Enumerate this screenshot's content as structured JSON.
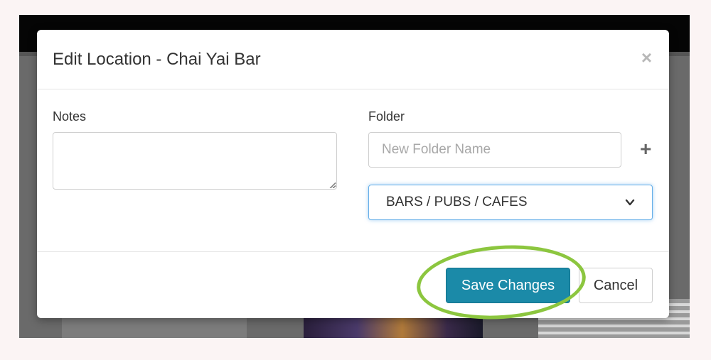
{
  "modal": {
    "title": "Edit Location - Chai Yai Bar",
    "close_label": "×"
  },
  "notes": {
    "label": "Notes",
    "value": ""
  },
  "folder": {
    "label": "Folder",
    "new_folder_placeholder": "New Folder Name",
    "add_label": "+",
    "selected": "BARS / PUBS / CAFES"
  },
  "footer": {
    "save_label": "Save Changes",
    "cancel_label": "Cancel"
  },
  "colors": {
    "primary": "#1b8aa8",
    "highlight": "#8cc63f",
    "focus": "#66afe9"
  }
}
